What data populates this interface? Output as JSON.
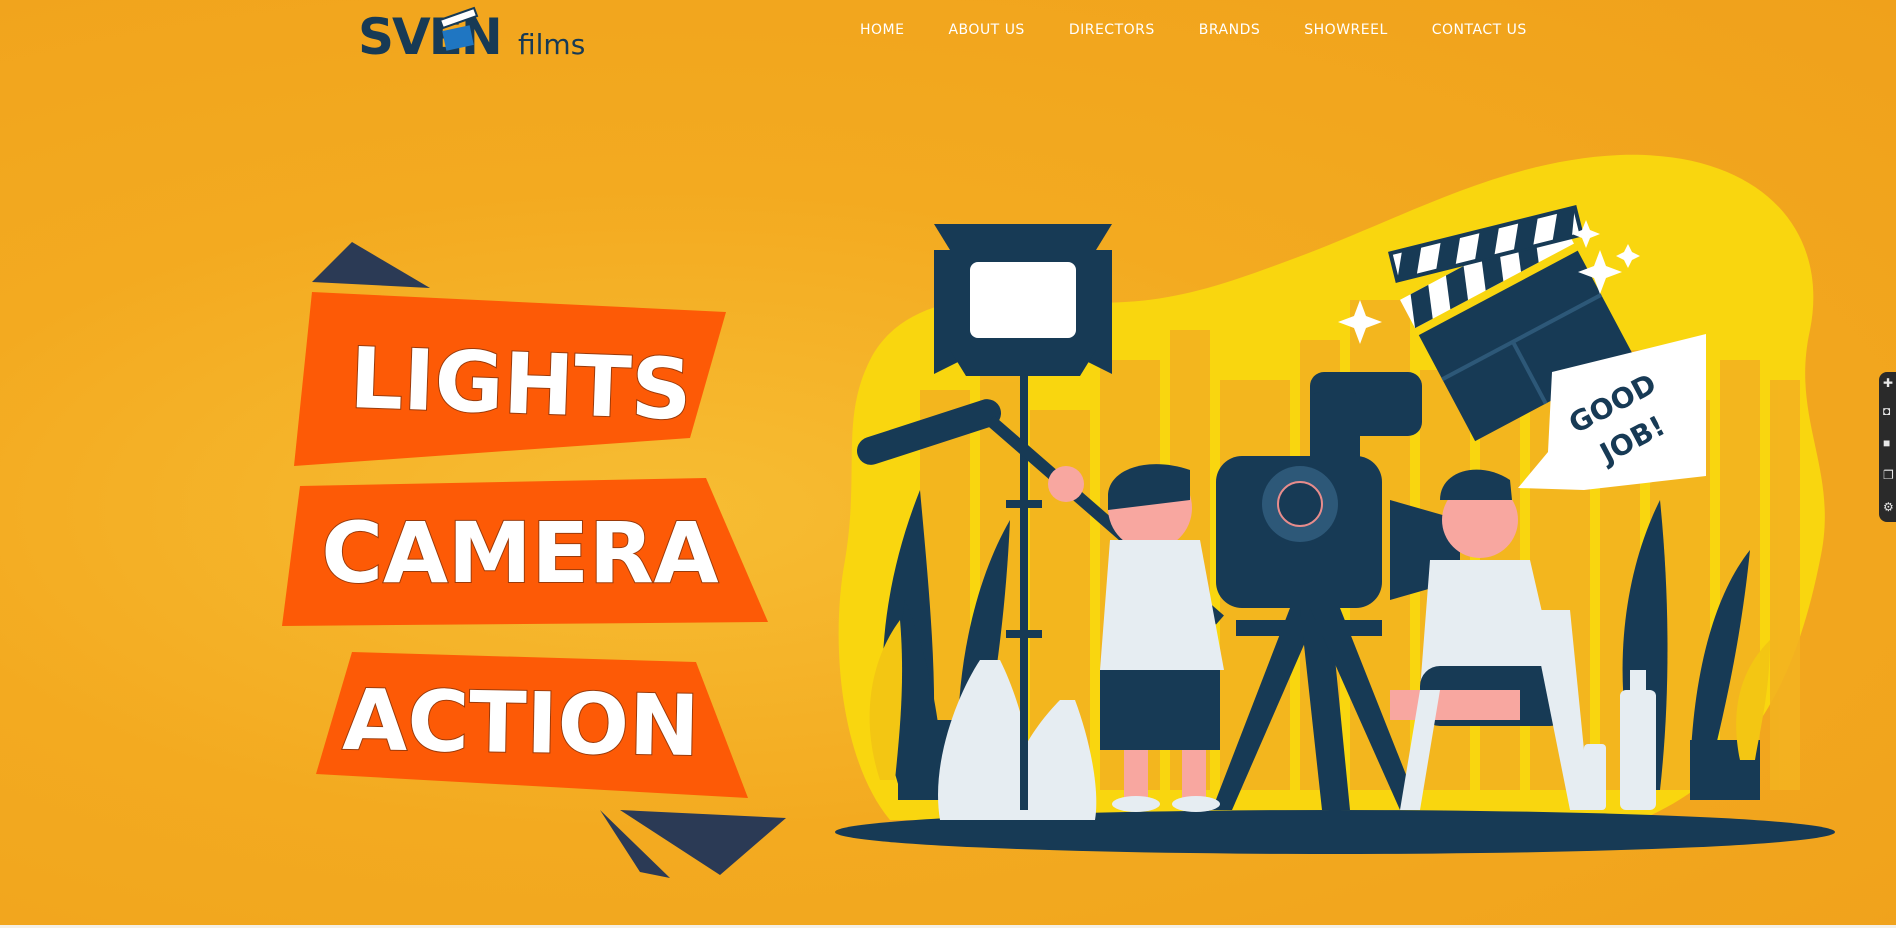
{
  "logo": {
    "main": "SVEN",
    "sub": "films"
  },
  "nav": {
    "items": [
      {
        "label": "HOME"
      },
      {
        "label": "ABOUT US"
      },
      {
        "label": "DIRECTORS"
      },
      {
        "label": "BRANDS"
      },
      {
        "label": "SHOWREEL"
      },
      {
        "label": "CONTACT US"
      }
    ]
  },
  "hero": {
    "banner1": "LIGHTS",
    "banner2": "CAMERA",
    "banner3": "ACTION",
    "speech": {
      "line1": "GOOD",
      "line2": "JOB!"
    }
  },
  "side_tools": [
    "pin-icon",
    "camera-icon",
    "square-icon",
    "layers-icon",
    "gear-icon"
  ],
  "colors": {
    "background": "#f2a81f",
    "banner": "#fd5a06",
    "navy": "#173a55",
    "dark_triangle": "#2b3a55",
    "yellow_blob": "#f9d60f",
    "text": "#ffffff"
  }
}
